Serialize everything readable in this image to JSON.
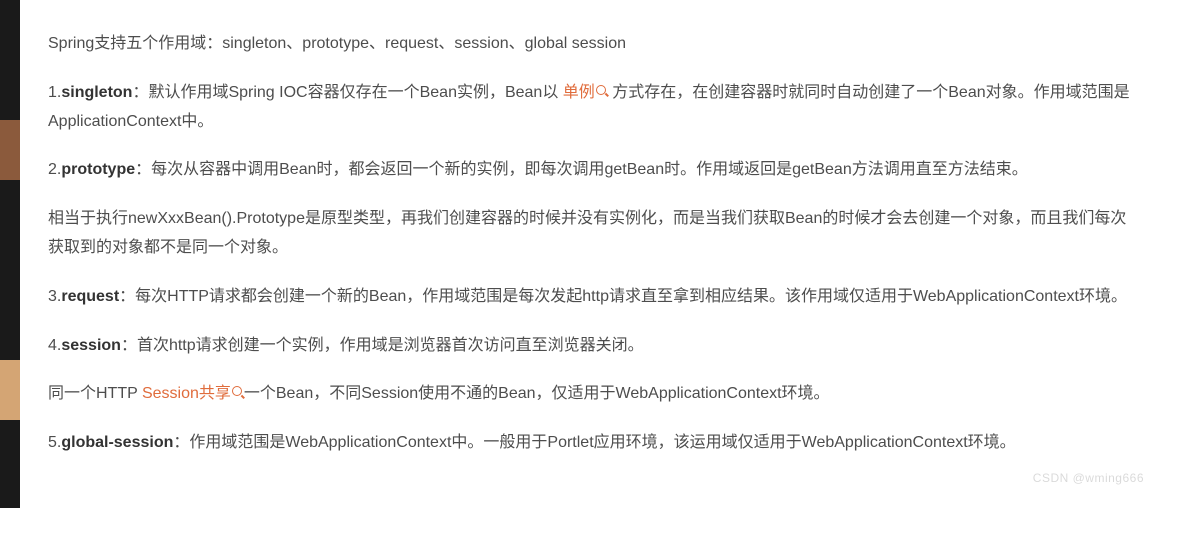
{
  "intro": "Spring支持五个作用域：singleton、prototype、request、session、global session",
  "items": {
    "s1": {
      "num": "1.",
      "term": "singleton",
      "pre": "：默认作用域Spring IOC容器仅存在一个Bean实例，Bean以 ",
      "link": "单例",
      "post": " 方式存在，在创建容器时就同时自动创建了一个Bean对象。作用域范围是ApplicationContext中。"
    },
    "s2": {
      "num": "2.",
      "term": "prototype",
      "text": "：每次从容器中调用Bean时，都会返回一个新的实例，即每次调用getBean时。作用域返回是getBean方法调用直至方法结束。",
      "extra": "相当于执行newXxxBean().Prototype是原型类型，再我们创建容器的时候并没有实例化，而是当我们获取Bean的时候才会去创建一个对象，而且我们每次获取到的对象都不是同一个对象。"
    },
    "s3": {
      "num": "3.",
      "term": "request",
      "text": "：每次HTTP请求都会创建一个新的Bean，作用域范围是每次发起http请求直至拿到相应结果。该作用域仅适用于WebApplicationContext环境。"
    },
    "s4": {
      "num": "4.",
      "term": "session",
      "text": "：首次http请求创建一个实例，作用域是浏览器首次访问直至浏览器关闭。",
      "extra_pre": "同一个HTTP ",
      "extra_link": "Session共享",
      "extra_post": "一个Bean，不同Session使用不通的Bean，仅适用于WebApplicationContext环境。"
    },
    "s5": {
      "num": "5.",
      "term": "global-session",
      "text": "：作用域范围是WebApplicationContext中。一般用于Portlet应用环境，该运用域仅适用于WebApplicationContext环境。"
    }
  },
  "watermark": "CSDN @wming666"
}
